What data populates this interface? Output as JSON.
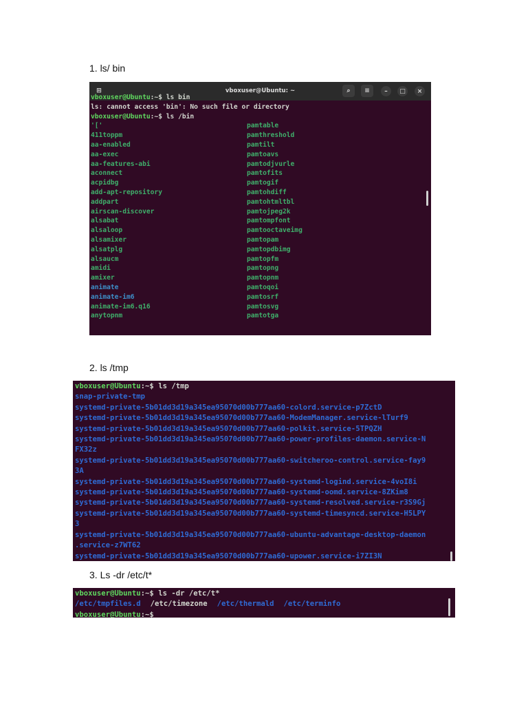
{
  "sections": [
    {
      "label": "1.  ls/ bin"
    },
    {
      "label": "2.  ls /tmp"
    },
    {
      "label": "3.  Ls -dr /etc/t*"
    }
  ],
  "terminal1": {
    "title": "vboxuser@Ubuntu: ~",
    "prompt_user": "vboxuser@Ubuntu",
    "prompt_path": ":~$ ",
    "cmd1": "ls bin",
    "error": "ls: cannot access 'bin': No such file or directory",
    "cmd2": "ls /bin",
    "left": [
      "'['",
      "411toppm",
      "aa-enabled",
      "aa-exec",
      "aa-features-abi",
      "aconnect",
      "acpidbg",
      "add-apt-repository",
      "addpart",
      "airscan-discover",
      "alsabat",
      "alsaloop",
      "alsamixer",
      "alsatplg",
      "alsaucm",
      "amidi",
      "amixer",
      "animate",
      "animate-im6",
      "animate-im6.q16",
      "anytopnm"
    ],
    "right": [
      "pamtable",
      "pamthreshold",
      "pamtilt",
      "pamtoavs",
      "pamtodjvurle",
      "pamtofits",
      "pamtogif",
      "pamtohdiff",
      "pamtohtmltbl",
      "pamtojpeg2k",
      "pamtompfont",
      "pamtooctaveimg",
      "pamtopam",
      "pamtopdbimg",
      "pamtopfm",
      "pamtopng",
      "pamtopnm",
      "pamtoqoi",
      "pamtosrf",
      "pamtosvg",
      "pamtotga"
    ],
    "symlink_items": [
      "animate",
      "animate-im6"
    ]
  },
  "terminal2": {
    "prompt_user": "vboxuser@Ubuntu",
    "prompt_path": ":~$ ",
    "cmd": "ls /tmp",
    "output": [
      "snap-private-tmp",
      "systemd-private-5b01dd3d19a345ea95070d00b777aa60-colord.service-p7ZctD",
      "systemd-private-5b01dd3d19a345ea95070d00b777aa60-ModemManager.service-lTurf9",
      "systemd-private-5b01dd3d19a345ea95070d00b777aa60-polkit.service-5TPQZH",
      "systemd-private-5b01dd3d19a345ea95070d00b777aa60-power-profiles-daemon.service-N",
      "FX32z",
      "systemd-private-5b01dd3d19a345ea95070d00b777aa60-switcheroo-control.service-fay9",
      "3A",
      "systemd-private-5b01dd3d19a345ea95070d00b777aa60-systemd-logind.service-4voI8i",
      "systemd-private-5b01dd3d19a345ea95070d00b777aa60-systemd-oomd.service-8ZKim8",
      "systemd-private-5b01dd3d19a345ea95070d00b777aa60-systemd-resolved.service-r3S9Gj",
      "systemd-private-5b01dd3d19a345ea95070d00b777aa60-systemd-timesyncd.service-H5LPY",
      "3",
      "systemd-private-5b01dd3d19a345ea95070d00b777aa60-ubuntu-advantage-desktop-daemon",
      ".service-z7WT62",
      "systemd-private-5b01dd3d19a345ea95070d00b777aa60-upower.service-i7ZI3N"
    ]
  },
  "terminal3": {
    "prompt_user": "vboxuser@Ubuntu",
    "prompt_path": ":~$ ",
    "cmd": "ls -dr /etc/t*",
    "output": [
      {
        "text": "/etc/tmpfiles.d",
        "type": "dir"
      },
      {
        "text": "/etc/timezone",
        "type": "file"
      },
      {
        "text": "/etc/thermald",
        "type": "dir"
      },
      {
        "text": "/etc/terminfo",
        "type": "dir"
      }
    ]
  },
  "colors": {
    "terminal_bg": "#300a24",
    "prompt": "#5fd75f",
    "exec": "#3fae6a",
    "dir": "#2f6bd4"
  }
}
